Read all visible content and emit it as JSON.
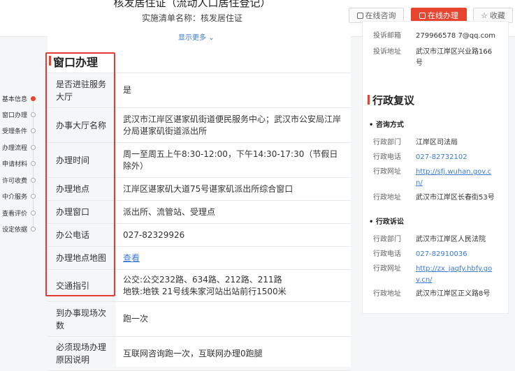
{
  "header": {
    "title": "核发居住证（流动人口居住登记）",
    "list_name": "实施清单名称：核发居住证",
    "btn_consult": "在线咨询",
    "btn_handle": "在线办理",
    "btn_favorite": "收藏",
    "show_more": "显示更多"
  },
  "nav": {
    "items": [
      "基本信息",
      "窗口办理",
      "受理条件",
      "办理流程",
      "申请材料",
      "许可收费",
      "中介服务",
      "查看评价",
      "设定依据"
    ],
    "active_index": 0
  },
  "window": {
    "section_title": "窗口办理",
    "rows": [
      {
        "label": "是否进驻服务大厅",
        "value": "是"
      },
      {
        "label": "办事大厅名称",
        "value": "武汉市江岸区谌家矶街道便民服务中心；武汉市公安局江岸分局谌家矶街道派出所"
      },
      {
        "label": "办理时间",
        "value": "周一至周五上午8:30-12:00，下午14:30-17:30（节假日除外）"
      },
      {
        "label": "办理地点",
        "value": "江岸区谌家矶大道75号谌家矶派出所综合窗口"
      },
      {
        "label": "办理窗口",
        "value": "派出所、流管站、受理点"
      },
      {
        "label": "办公电话",
        "value": "027-82329926"
      },
      {
        "label": "办理地点地图",
        "value": "查看"
      },
      {
        "label": "交通指引",
        "value_lines": [
          "公交:公交232路、634路、212路、211路",
          "地铁:地铁 21号线朱家河站出站前行1500米"
        ]
      },
      {
        "label": "到办事现场次数",
        "value": "跑一次"
      },
      {
        "label": "必须现场办理原因说明",
        "value": "互联网咨询跑一次，互联网办理0跑腿"
      }
    ]
  },
  "complaint": {
    "email_label": "投诉邮箱",
    "email_value": "279966578 7@qq.com",
    "address_label": "投诉地址",
    "address_value": "武汉市江岸区兴业路166号"
  },
  "review": {
    "title": "行政复议",
    "consult_title": "咨询方式",
    "consult": [
      {
        "label": "行政部门",
        "value": "江岸区司法局"
      },
      {
        "label": "行政电话",
        "value": "027-82732102"
      },
      {
        "label": "行政网址",
        "value": "http://sfj.wuhan.gov.cn/"
      },
      {
        "label": "行政地址",
        "value": "武汉市江岸区长春街53号"
      }
    ],
    "litigation_title": "行政诉讼",
    "litigation": [
      {
        "label": "行政部门",
        "value": "武汉市江岸区人民法院"
      },
      {
        "label": "行政电话",
        "value": "027-82910036"
      },
      {
        "label": "行政网址",
        "value": "http://zx_jaqfy.hbfy.gov.cn/"
      },
      {
        "label": "行政地址",
        "value": "武汉市江岸区正义路8号"
      }
    ]
  }
}
